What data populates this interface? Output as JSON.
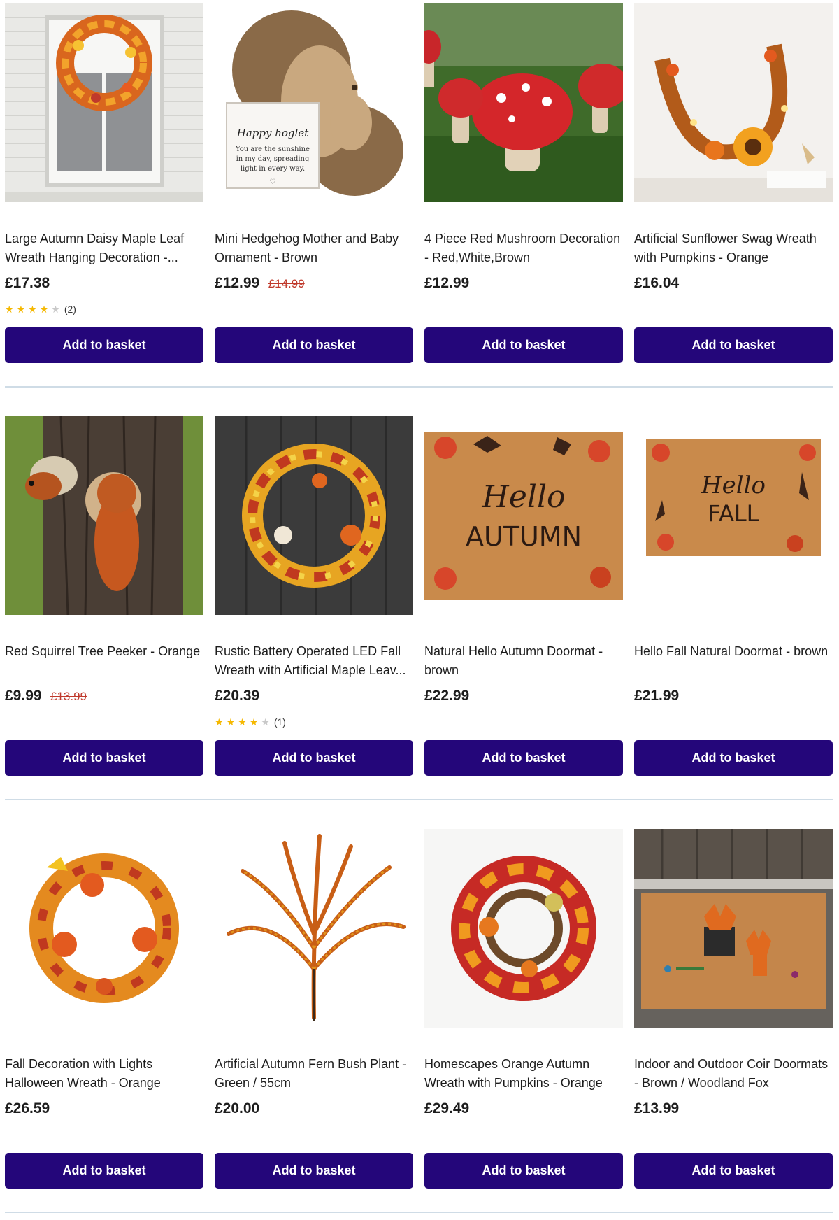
{
  "theme": {
    "button_color": "#24067a",
    "sale_color": "#c0392b",
    "star_color": "#f5b800"
  },
  "products": [
    {
      "title": "Large Autumn Daisy Maple Leaf Wreath Hanging Decoration -...",
      "price": "£17.38",
      "was": "",
      "rating": 4,
      "rating_count": "(2)",
      "button": "Add to basket",
      "image": "autumn-wreath-on-window-image"
    },
    {
      "title": "Mini Hedgehog Mother and Baby Ornament - Brown",
      "price": "£12.99",
      "was": "£14.99",
      "rating": 0,
      "rating_count": "",
      "button": "Add to basket",
      "image": "hedgehog-ornament-image",
      "image_text": [
        "Happy hoglet",
        "You are the sunshine",
        "in my day, spreading",
        "light in every way."
      ]
    },
    {
      "title": "4 Piece Red Mushroom Decoration - Red,White,Brown",
      "price": "£12.99",
      "was": "",
      "rating": 0,
      "rating_count": "",
      "button": "Add to basket",
      "image": "red-mushroom-image"
    },
    {
      "title": "Artificial Sunflower Swag Wreath with Pumpkins - Orange",
      "price": "£16.04",
      "was": "",
      "rating": 0,
      "rating_count": "",
      "button": "Add to basket",
      "image": "sunflower-swag-image"
    },
    {
      "title": "Red Squirrel Tree Peeker - Orange",
      "price": "£9.99",
      "was": "£13.99",
      "rating": 0,
      "rating_count": "",
      "button": "Add to basket",
      "image": "squirrel-peeker-image"
    },
    {
      "title": "Rustic Battery Operated LED Fall Wreath with Artificial Maple Leav...",
      "price": "£20.39",
      "was": "",
      "rating": 4,
      "rating_count": "(1)",
      "button": "Add to basket",
      "image": "rustic-led-wreath-image"
    },
    {
      "title": "Natural Hello Autumn Doormat - brown",
      "price": "£22.99",
      "was": "",
      "rating": 0,
      "rating_count": "",
      "button": "Add to basket",
      "image": "hello-autumn-doormat-image",
      "image_text": [
        "Hello",
        "AUTUMN"
      ]
    },
    {
      "title": "Hello Fall Natural Doormat - brown",
      "price": "£21.99",
      "was": "",
      "rating": 0,
      "rating_count": "",
      "button": "Add to basket",
      "image": "hello-fall-doormat-image",
      "image_text": [
        "Hello",
        "FALL"
      ]
    },
    {
      "title": "Fall Decoration with Lights Halloween Wreath - Orange",
      "price": "£26.59",
      "was": "",
      "rating": 0,
      "rating_count": "",
      "button": "Add to basket",
      "image": "fall-lights-wreath-image"
    },
    {
      "title": "Artificial Autumn Fern Bush Plant - Green / 55cm",
      "price": "£20.00",
      "was": "",
      "rating": 0,
      "rating_count": "",
      "button": "Add to basket",
      "image": "fern-bush-image"
    },
    {
      "title": "Homescapes Orange Autumn Wreath with Pumpkins - Orange",
      "price": "£29.49",
      "was": "",
      "rating": 0,
      "rating_count": "",
      "button": "Add to basket",
      "image": "orange-autumn-wreath-image"
    },
    {
      "title": "Indoor and Outdoor Coir Doormats - Brown / Woodland Fox",
      "price": "£13.99",
      "was": "",
      "rating": 0,
      "rating_count": "",
      "button": "Add to basket",
      "image": "woodland-fox-doormat-image"
    }
  ]
}
